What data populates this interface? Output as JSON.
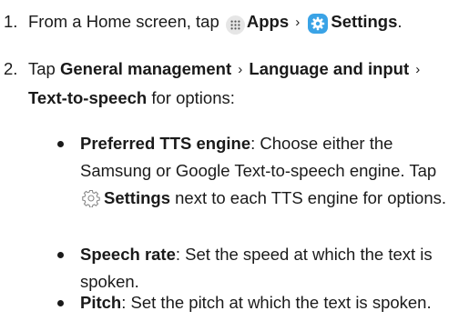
{
  "steps": [
    {
      "number": "1.",
      "lead": "From a Home screen, tap",
      "apps_label": "Apps",
      "chevron": "›",
      "settings_label": "Settings",
      "end": "."
    },
    {
      "number": "2.",
      "lead": "Tap",
      "path1": "General management",
      "chevron1": "›",
      "path2": "Language and input",
      "chevron2": "›",
      "path3": "Text-to-speech",
      "tail": "for options:"
    }
  ],
  "bullets": [
    {
      "term": "Preferred TTS engine",
      "sep": ":",
      "text1": "Choose either the Samsung or Google Text-to-speech engine. Tap",
      "settings_label": "Settings",
      "text2": "next to each TTS engine for options."
    },
    {
      "term": "Speech rate",
      "sep": ":",
      "text": "Set the speed at which the text is spoken."
    },
    {
      "term": "Pitch",
      "sep": ":",
      "text": "Set the pitch at which the text is spoken."
    }
  ],
  "colors": {
    "text": "#1a1a1a",
    "settings_icon_bg": "#3aa3e6",
    "apps_icon_bg": "#e6e6e6"
  },
  "icons": {
    "apps": "apps-grid-icon",
    "settings_app": "settings-app-icon",
    "settings_gear": "gear-outline-icon"
  }
}
